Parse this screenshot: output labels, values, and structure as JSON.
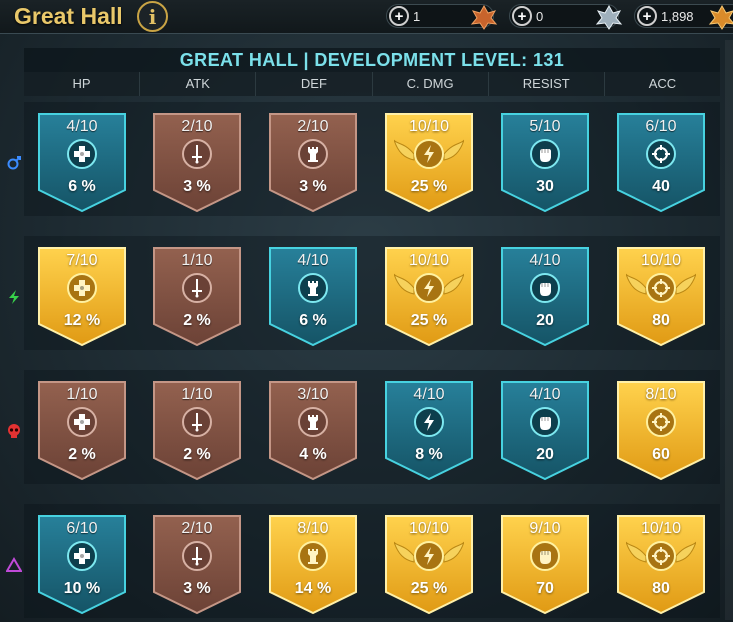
{
  "header": {
    "title": "Great Hall",
    "info_icon": "info-icon",
    "resources": [
      {
        "value": "1",
        "icon": "bronze-medal-icon",
        "color": "#d2793c"
      },
      {
        "value": "0",
        "icon": "silver-medal-icon",
        "color": "#c7cfd6"
      },
      {
        "value": "1,898",
        "icon": "gold-medal-icon",
        "color": "#d98b2a"
      }
    ]
  },
  "banner": "GREAT HALL | DEVELOPMENT LEVEL: 131",
  "columns": [
    "HP",
    "ATK",
    "DEF",
    "C. DMG",
    "RESIST",
    "ACC"
  ],
  "colors": {
    "blue": "#1d6b7e",
    "bronze": "#8a5a4c",
    "gold": "#f0b72c",
    "banner_text": "#7be0ea"
  },
  "rows": [
    {
      "affinity": "magic",
      "affinity_icon": "magic-affinity-icon",
      "cells": [
        {
          "level": "4/10",
          "value": "6 %",
          "tier": "blue"
        },
        {
          "level": "2/10",
          "value": "3 %",
          "tier": "bronze"
        },
        {
          "level": "2/10",
          "value": "3 %",
          "tier": "bronze"
        },
        {
          "level": "10/10",
          "value": "25 %",
          "tier": "gold"
        },
        {
          "level": "5/10",
          "value": "30",
          "tier": "blue"
        },
        {
          "level": "6/10",
          "value": "40",
          "tier": "blue"
        }
      ]
    },
    {
      "affinity": "spirit",
      "affinity_icon": "spirit-affinity-icon",
      "cells": [
        {
          "level": "7/10",
          "value": "12 %",
          "tier": "gold"
        },
        {
          "level": "1/10",
          "value": "2 %",
          "tier": "bronze"
        },
        {
          "level": "4/10",
          "value": "6 %",
          "tier": "blue"
        },
        {
          "level": "10/10",
          "value": "25 %",
          "tier": "gold"
        },
        {
          "level": "4/10",
          "value": "20",
          "tier": "blue"
        },
        {
          "level": "10/10",
          "value": "80",
          "tier": "gold"
        }
      ]
    },
    {
      "affinity": "force",
      "affinity_icon": "force-affinity-icon",
      "cells": [
        {
          "level": "1/10",
          "value": "2 %",
          "tier": "bronze"
        },
        {
          "level": "1/10",
          "value": "2 %",
          "tier": "bronze"
        },
        {
          "level": "3/10",
          "value": "4 %",
          "tier": "bronze"
        },
        {
          "level": "4/10",
          "value": "8 %",
          "tier": "blue"
        },
        {
          "level": "4/10",
          "value": "20",
          "tier": "blue"
        },
        {
          "level": "8/10",
          "value": "60",
          "tier": "gold"
        }
      ]
    },
    {
      "affinity": "void",
      "affinity_icon": "void-affinity-icon",
      "cells": [
        {
          "level": "6/10",
          "value": "10 %",
          "tier": "blue"
        },
        {
          "level": "2/10",
          "value": "3 %",
          "tier": "bronze"
        },
        {
          "level": "8/10",
          "value": "14 %",
          "tier": "gold"
        },
        {
          "level": "10/10",
          "value": "25 %",
          "tier": "gold"
        },
        {
          "level": "9/10",
          "value": "70",
          "tier": "gold"
        },
        {
          "level": "10/10",
          "value": "80",
          "tier": "gold"
        }
      ]
    }
  ],
  "stat_icons": [
    "hp-cross-icon",
    "atk-sword-icon",
    "def-tower-icon",
    "crit-damage-bolt-icon",
    "resist-fist-icon",
    "acc-crosshair-icon"
  ]
}
